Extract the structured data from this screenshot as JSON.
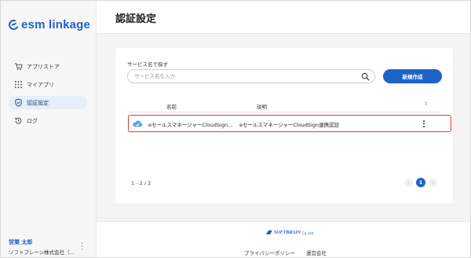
{
  "app": {
    "logo_text": "esm linkage",
    "brand_color": "#1f63c8"
  },
  "sidebar": {
    "items": [
      {
        "label": "アプリストア",
        "icon": "cart-icon",
        "active": false
      },
      {
        "label": "マイアプリ",
        "icon": "grid-icon",
        "active": false
      },
      {
        "label": "認証設定",
        "icon": "shield-icon",
        "active": true
      },
      {
        "label": "ログ",
        "icon": "history-icon",
        "active": false
      }
    ],
    "user": {
      "name": "営業 太郎",
      "company": "ソフトブレーン株式会社（..."
    }
  },
  "header": {
    "title": "認証設定"
  },
  "search": {
    "label": "サービス名で探す",
    "placeholder": "サービス名を入力"
  },
  "toolbar": {
    "new_button_label": "新規作成"
  },
  "table": {
    "columns": {
      "name": "名前",
      "description": "説明",
      "sort_icon": "sort-icon"
    },
    "rows": [
      {
        "name": "eセールスマネージャーCloudSign...",
        "description": "eセールスマネージャーCloudSign連携認証",
        "icon": "cloud-icon"
      }
    ]
  },
  "pagination": {
    "range": "1 - 2 / 2",
    "current_page": "1",
    "prev": "‹",
    "next": "›"
  },
  "footer": {
    "logo_text": "SOFTBRAIN",
    "logo_sub": "Co.,Ltd.",
    "links": [
      "プライバシーポリシー",
      "運営会社"
    ]
  },
  "colors": {
    "highlight_border": "#e23b3b",
    "accent": "#1f63c8"
  }
}
